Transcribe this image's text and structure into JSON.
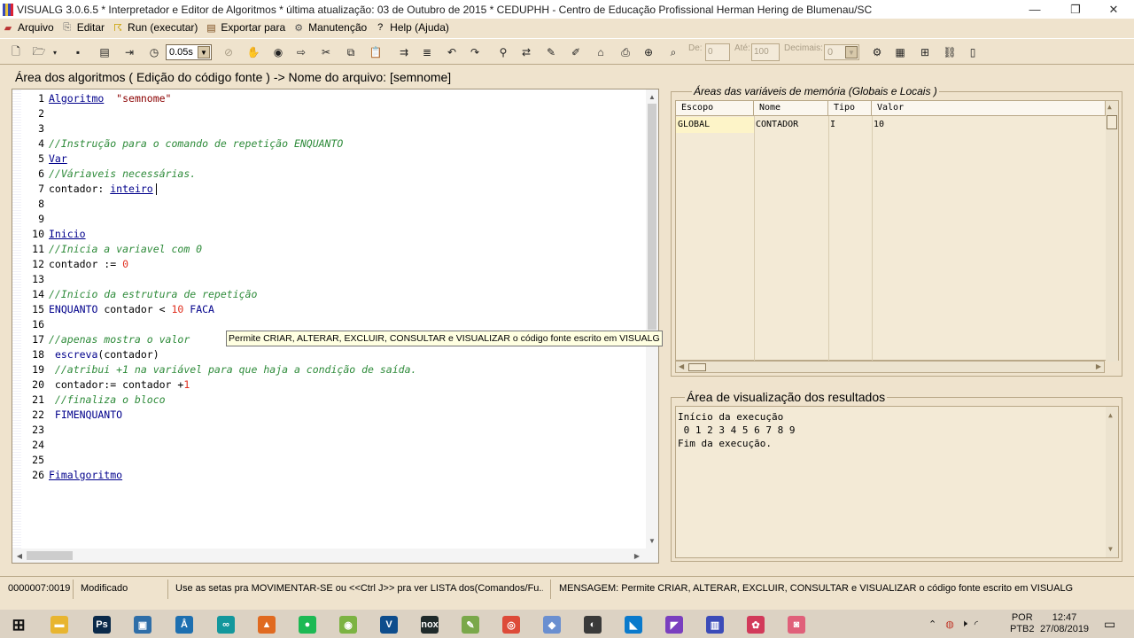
{
  "window": {
    "title": "VISUALG 3.0.6.5 * Interpretador e Editor de Algoritmos * última atualização: 03 de Outubro de 2015 * CEDUPHH - Centro de Educação Profissional Herman Hering de Blumenau/SC",
    "controls": [
      "—",
      "❐",
      "✕"
    ]
  },
  "menu": [
    {
      "label": "Arquivo",
      "icon": "folder-icon"
    },
    {
      "label": "Editar",
      "icon": "edit-icon"
    },
    {
      "label": "Run (executar)",
      "icon": "run-icon"
    },
    {
      "label": "Exportar para",
      "icon": "export-icon"
    },
    {
      "label": "Manutenção",
      "icon": "maintenance-icon"
    },
    {
      "label": "Help (Ajuda)",
      "icon": "help-icon"
    }
  ],
  "toolbar": {
    "speed_value": "0.05s",
    "de_label": "De:",
    "de_value": "0",
    "ate_label": "Até:",
    "ate_value": "100",
    "decimais_label": "Decimais:",
    "decimais_value": "0"
  },
  "editor": {
    "title": "Área dos algoritmos ( Edição do código fonte ) -> Nome do arquivo: [semnome]",
    "lines": [
      {
        "n": "1",
        "tokens": [
          [
            "kw",
            "Algoritmo"
          ],
          [
            "",
            "  "
          ],
          [
            "str",
            "\"semnome\""
          ]
        ]
      },
      {
        "n": "2",
        "tokens": []
      },
      {
        "n": "3",
        "tokens": []
      },
      {
        "n": "4",
        "tokens": [
          [
            "cm",
            "//Instrução para o comando de repetição ENQUANTO"
          ]
        ]
      },
      {
        "n": "5",
        "tokens": [
          [
            "kw",
            "Var"
          ]
        ]
      },
      {
        "n": "6",
        "tokens": [
          [
            "cm",
            "//Váriaveis necessárias."
          ]
        ]
      },
      {
        "n": "7",
        "tokens": [
          [
            "",
            "contador: "
          ],
          [
            "kw",
            "inteiro"
          ]
        ],
        "caret": true
      },
      {
        "n": "8",
        "tokens": []
      },
      {
        "n": "9",
        "tokens": []
      },
      {
        "n": "10",
        "tokens": [
          [
            "kw",
            "Inicio"
          ]
        ]
      },
      {
        "n": "11",
        "tokens": [
          [
            "cm",
            "//Inicia a variavel com 0"
          ]
        ]
      },
      {
        "n": "12",
        "tokens": [
          [
            "",
            "contador := "
          ],
          [
            "num",
            "0"
          ]
        ]
      },
      {
        "n": "13",
        "tokens": []
      },
      {
        "n": "14",
        "tokens": [
          [
            "cm",
            "//Inicio da estrutura de repetição"
          ]
        ]
      },
      {
        "n": "15",
        "tokens": [
          [
            "kw2",
            "ENQUANTO"
          ],
          [
            "",
            " contador < "
          ],
          [
            "num",
            "10"
          ],
          [
            "kw2",
            " FACA"
          ]
        ]
      },
      {
        "n": "16",
        "tokens": []
      },
      {
        "n": "17",
        "tokens": [
          [
            "cm",
            "//apenas mostra o valor"
          ]
        ]
      },
      {
        "n": "18",
        "tokens": [
          [
            "",
            " "
          ],
          [
            "fn",
            "escreva"
          ],
          [
            "",
            "(contador)"
          ]
        ]
      },
      {
        "n": "19",
        "tokens": [
          [
            "cm",
            " //atribui +1 na variável para que haja a condição de saída."
          ]
        ]
      },
      {
        "n": "20",
        "tokens": [
          [
            "",
            " contador:= contador +"
          ],
          [
            "num",
            "1"
          ]
        ]
      },
      {
        "n": "21",
        "tokens": [
          [
            "cm",
            " //finaliza o bloco"
          ]
        ]
      },
      {
        "n": "22",
        "tokens": [
          [
            "kw2",
            " FIMENQUANTO"
          ]
        ]
      },
      {
        "n": "23",
        "tokens": []
      },
      {
        "n": "24",
        "tokens": []
      },
      {
        "n": "25",
        "tokens": []
      },
      {
        "n": "26",
        "tokens": [
          [
            "kw",
            "Fimalgoritmo"
          ]
        ]
      }
    ]
  },
  "tooltip": "Permite CRIAR, ALTERAR, EXCLUIR, CONSULTAR e VISUALIZAR o código fonte escrito em VISUALG",
  "variables": {
    "title": "Áreas das variáveis de memória (Globais e Locais )",
    "columns": [
      "Escopo",
      "Nome",
      "Tipo",
      "Valor"
    ],
    "rows": [
      [
        "GLOBAL",
        "CONTADOR",
        "I",
        "10"
      ]
    ]
  },
  "results": {
    "title": "Área de visualização dos resultados",
    "lines": [
      "Início da execução",
      " 0 1 2 3 4 5 6 7 8 9",
      "Fim da execução."
    ]
  },
  "status": {
    "position": "0000007:0019",
    "state": "Modificado",
    "hint": "Use as setas pra MOVIMENTAR-SE ou <<Ctrl J>> pra ver LISTA dos(Comandos/Fu...",
    "message": "MENSAGEM: Permite CRIAR, ALTERAR, EXCLUIR, CONSULTAR e VISUALIZAR o código fonte escrito em VISUALG"
  },
  "taskbar": {
    "apps": [
      {
        "name": "windows-start",
        "glyph": "⊞",
        "color": "#1a1a1a"
      },
      {
        "name": "file-explorer",
        "glyph": "▬",
        "color": "#e8b530"
      },
      {
        "name": "photoshop",
        "glyph": "Ps",
        "color": "#0b2a4a"
      },
      {
        "name": "app-box",
        "glyph": "▣",
        "color": "#2f6ea8"
      },
      {
        "name": "app-a",
        "glyph": "Å",
        "color": "#1d6fb0"
      },
      {
        "name": "arduino",
        "glyph": "∞",
        "color": "#13979c"
      },
      {
        "name": "app-flame",
        "glyph": "▲",
        "color": "#e06a20"
      },
      {
        "name": "spotify",
        "glyph": "●",
        "color": "#1db954"
      },
      {
        "name": "android",
        "glyph": "◉",
        "color": "#7cb342"
      },
      {
        "name": "visualg-v",
        "glyph": "V",
        "color": "#0e4d8c"
      },
      {
        "name": "nox",
        "glyph": "nox",
        "color": "#1f2a2a"
      },
      {
        "name": "notepad",
        "glyph": "✎",
        "color": "#7aa84a"
      },
      {
        "name": "chrome",
        "glyph": "◎",
        "color": "#dd4b39"
      },
      {
        "name": "cube",
        "glyph": "◆",
        "color": "#6a8fd0"
      },
      {
        "name": "app-globe",
        "glyph": "◐",
        "color": "#3a3a3a"
      },
      {
        "name": "vscode",
        "glyph": "◣",
        "color": "#0a7acc"
      },
      {
        "name": "visual-studio",
        "glyph": "◤",
        "color": "#7a3fbf"
      },
      {
        "name": "visualg-task",
        "glyph": "▥",
        "color": "#3b4bb8"
      },
      {
        "name": "app-ball",
        "glyph": "✿",
        "color": "#d23a5a"
      },
      {
        "name": "app-camera",
        "glyph": "◙",
        "color": "#e0607a"
      }
    ],
    "lang_top": "POR",
    "lang_bottom": "PTB2",
    "time": "12:47",
    "date": "27/08/2019"
  }
}
